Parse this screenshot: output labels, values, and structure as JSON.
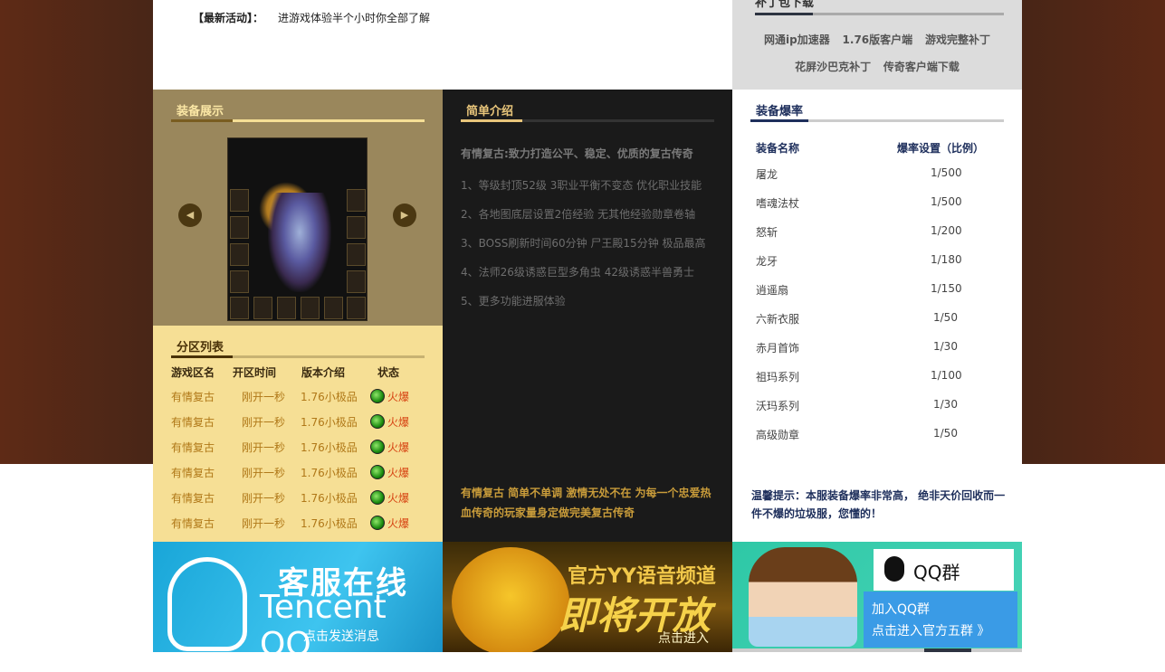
{
  "news": {
    "tag": "【最新活动】：",
    "text": "进游戏体验半个小时你全部了解"
  },
  "patch": {
    "title": "补丁包下载",
    "links": [
      "网通ip加速器",
      "1.76版客户端",
      "游戏完整补丁",
      "花屏沙巴克补丁",
      "传奇客户端下载"
    ]
  },
  "equip": {
    "title": "装备展示",
    "prev": "◀",
    "next": "▶"
  },
  "zone": {
    "title": "分区列表",
    "headers": [
      "游戏区名",
      "开区时间",
      "版本介绍",
      "状态"
    ],
    "rows": [
      [
        "有情复古",
        "刚开一秒",
        "1.76小极品",
        "火爆"
      ],
      [
        "有情复古",
        "刚开一秒",
        "1.76小极品",
        "火爆"
      ],
      [
        "有情复古",
        "刚开一秒",
        "1.76小极品",
        "火爆"
      ],
      [
        "有情复古",
        "刚开一秒",
        "1.76小极品",
        "火爆"
      ],
      [
        "有情复古",
        "刚开一秒",
        "1.76小极品",
        "火爆"
      ],
      [
        "有情复古",
        "刚开一秒",
        "1.76小极品",
        "火爆"
      ]
    ]
  },
  "intro": {
    "title": "简单介绍",
    "lead": "有情复古:致力打造公平、稳定、优质的复古传奇",
    "items": [
      "1、等级封顶52级 3职业平衡不变态 优化职业技能",
      "2、各地图底层设置2倍经验 无其他经验勋章卷轴",
      "3、BOSS刷新时间60分钟 尸王殿15分钟 极品最高",
      "4、法师26级诱惑巨型多角虫 42级诱惑半兽勇士",
      "5、更多功能进服体验"
    ],
    "footer": "有情复古 简单不单调 激情无处不在 为每一个忠爱热血传奇的玩家量身定做完美复古传奇"
  },
  "rates": {
    "title": "装备爆率",
    "headers": [
      "装备名称",
      "爆率设置（比例）"
    ],
    "rows": [
      [
        "屠龙",
        "1/500"
      ],
      [
        "嗜魂法杖",
        "1/500"
      ],
      [
        "怒斩",
        "1/200"
      ],
      [
        "龙牙",
        "1/180"
      ],
      [
        "逍遥扇",
        "1/150"
      ],
      [
        "六新衣服",
        "1/50"
      ],
      [
        "赤月首饰",
        "1/30"
      ],
      [
        "祖玛系列",
        "1/100"
      ],
      [
        "沃玛系列",
        "1/30"
      ],
      [
        "高级勋章",
        "1/50"
      ]
    ],
    "footer": "温馨提示：本服装备爆率非常高， 绝非天价回收而一件不爆的垃圾服，您懂的！"
  },
  "banners": {
    "qq": {
      "title": "客服在线",
      "brand": "Tencent QQ",
      "cta": "点击发送消息"
    },
    "yy": {
      "title": "官方YY语音频道",
      "big": "即将开放",
      "cta": "点击进入"
    },
    "group": {
      "logo": "QQ群",
      "line1": "加入QQ群",
      "line2": "点击进入官方五群 》"
    }
  }
}
